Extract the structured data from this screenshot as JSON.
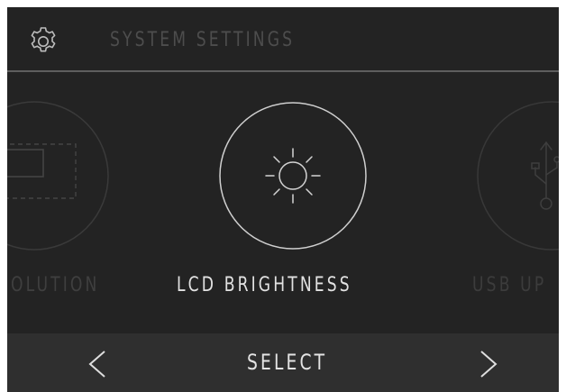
{
  "header": {
    "title": "SYSTEM SETTINGS",
    "icon": "gear-icon"
  },
  "carousel": {
    "items": [
      {
        "label": "OLUTION",
        "icon": "resolution-icon",
        "state": "partial-left"
      },
      {
        "label": "LCD BRIGHTNESS",
        "icon": "brightness-icon",
        "state": "selected"
      },
      {
        "label": "USB UP",
        "icon": "usb-icon",
        "state": "partial-right"
      }
    ]
  },
  "footer": {
    "prev_label": "<",
    "select_label": "SELECT",
    "next_label": ">"
  },
  "colors": {
    "background": "#232323",
    "footer_background": "#2f2f2f",
    "active_text": "#e2e2e2",
    "inactive_text": "#3f3f3f",
    "header_text": "#4d4d4d"
  }
}
